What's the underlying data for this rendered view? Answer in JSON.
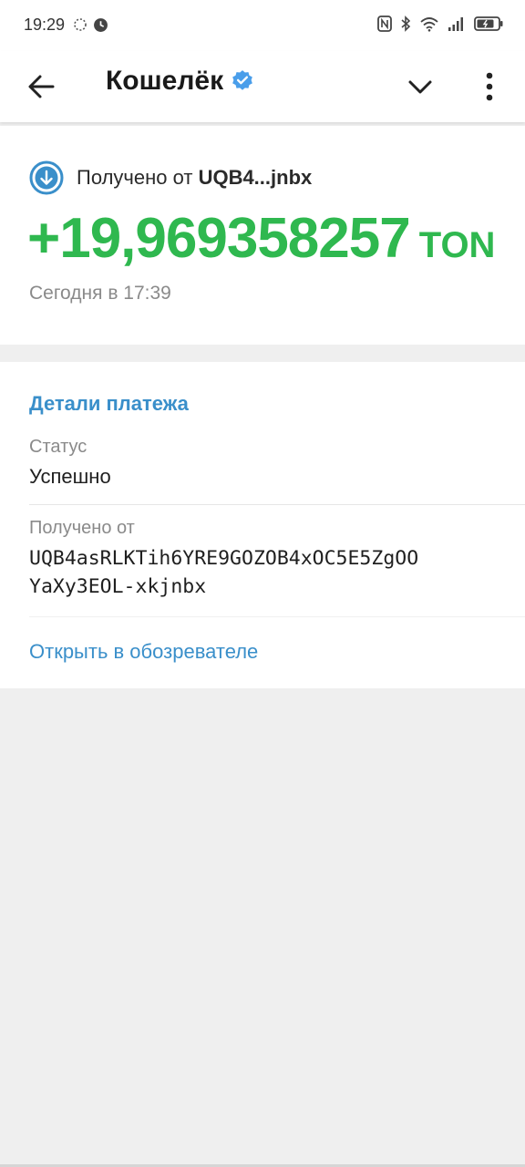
{
  "status_bar": {
    "time": "19:29"
  },
  "app_bar": {
    "title": "Кошелёк"
  },
  "transaction": {
    "received_prefix": "Получено от",
    "received_from_short": "UQB4...jnbx",
    "amount": "+19,969358257",
    "currency": "TON",
    "date": "Сегодня в 17:39"
  },
  "details": {
    "section_title": "Детали платежа",
    "status_label": "Статус",
    "status_value": "Успешно",
    "from_label": "Получено от",
    "from_address_line1": "UQB4asRLKTih6YRE9GOZOB4xOC5E5ZgOO",
    "from_address_line2": "YaXy3EOL-xkjnbx",
    "open_explorer": "Открыть в обозревателе"
  },
  "colors": {
    "accent": "#3a8fca",
    "amount_green": "#2fb84f",
    "verified_blue": "#4a9eea"
  }
}
